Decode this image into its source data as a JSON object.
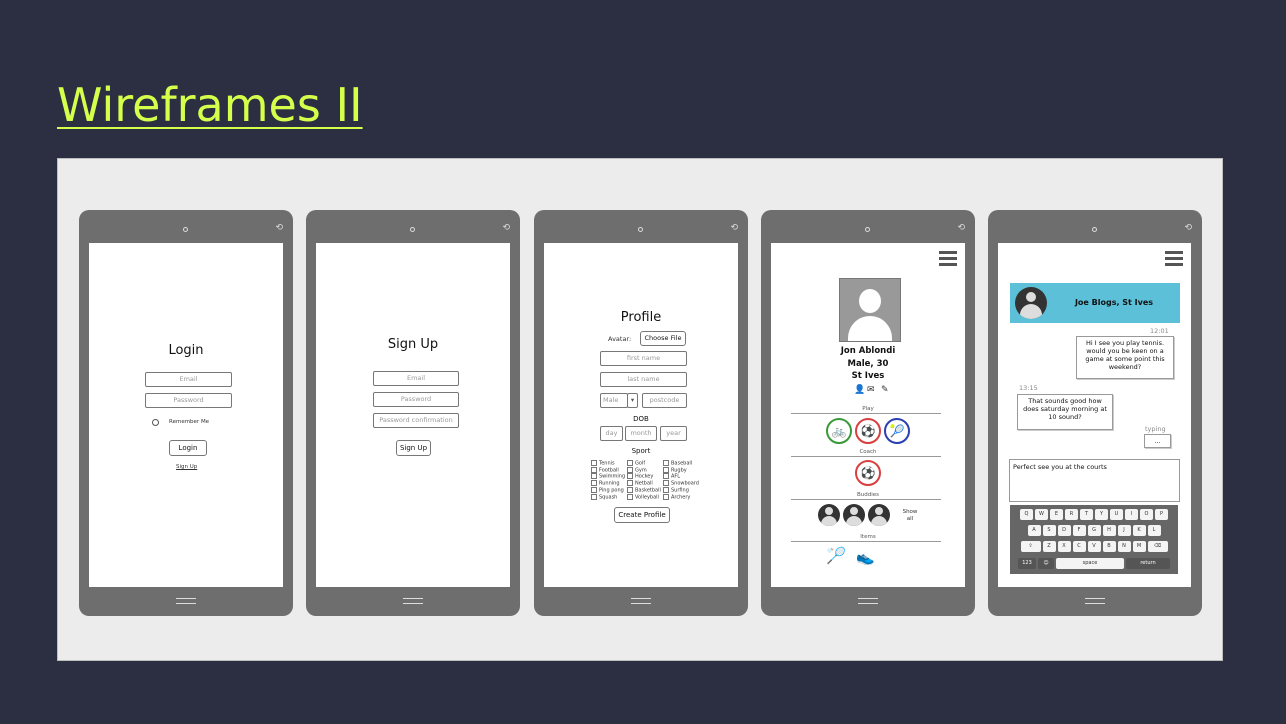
{
  "slide": {
    "title": "Wireframes II"
  },
  "login": {
    "title": "Login",
    "email_placeholder": "Email",
    "password_placeholder": "Password",
    "remember_label": "Remember Me",
    "login_button": "Login",
    "signup_link": "Sign Up"
  },
  "signup": {
    "title": "Sign Up",
    "email_placeholder": "Email",
    "password_placeholder": "Password",
    "confirm_placeholder": "Password confirmation",
    "signup_button": "Sign Up"
  },
  "profile_form": {
    "title": "Profile",
    "avatar_label": "Avatar:",
    "choose_file_button": "Choose File",
    "first_name_placeholder": "first name",
    "last_name_placeholder": "last name",
    "gender_value": "Male",
    "postcode_placeholder": "postcode",
    "dob_label": "DOB",
    "day_placeholder": "day",
    "month_placeholder": "month",
    "year_placeholder": "year",
    "sport_label": "Sport",
    "sports_col1": [
      "Tennis",
      "Football",
      "Swimming",
      "Running",
      "Ping pong",
      "Squash"
    ],
    "sports_col2": [
      "Golf",
      "Gym",
      "Hockey",
      "Netball",
      "Basketball",
      "Volleyball"
    ],
    "sports_col3": [
      "Baseball",
      "Rugby",
      "AFL",
      "Snowboard",
      "Surfing",
      "Archery"
    ],
    "create_button": "Create Profile"
  },
  "user_profile": {
    "name": "Jon Ablondi",
    "details": "Male, 30",
    "location": "St Ives",
    "play_label": "Play",
    "coach_label": "Coach",
    "buddies_label": "Buddies",
    "show_all": "Show all",
    "items_label": "Items",
    "play_icons": [
      "cycling-icon",
      "football-icon",
      "tennis-icon"
    ],
    "play_colors": [
      "#3a9a3a",
      "#d84040",
      "#2a3fb0"
    ]
  },
  "chat": {
    "contact": "Joe Blogs, St Ives",
    "time1": "12:01",
    "message1": "Hi I see you play tennis. would you be keen on a game at some point this weekend?",
    "time2": "13:15",
    "message2": "That sounds good how does saturday morning at 10 sound?",
    "typing_label": "typing",
    "typing_dots": "...",
    "draft": "Perfect see you at the courts",
    "row1": [
      "Q",
      "W",
      "E",
      "R",
      "T",
      "Y",
      "U",
      "I",
      "O",
      "P"
    ],
    "row2": [
      "A",
      "S",
      "D",
      "F",
      "G",
      "H",
      "J",
      "K",
      "L"
    ],
    "row3": [
      "Z",
      "X",
      "C",
      "V",
      "B",
      "N",
      "M"
    ],
    "num_key": "123",
    "space_key": "space",
    "return_key": "return",
    "header_color": "#5bc0d8"
  },
  "colors": {
    "background": "#2c2f42",
    "title": "#d4ff4a",
    "panel": "#ececec",
    "phone": "#6e6e6e"
  }
}
